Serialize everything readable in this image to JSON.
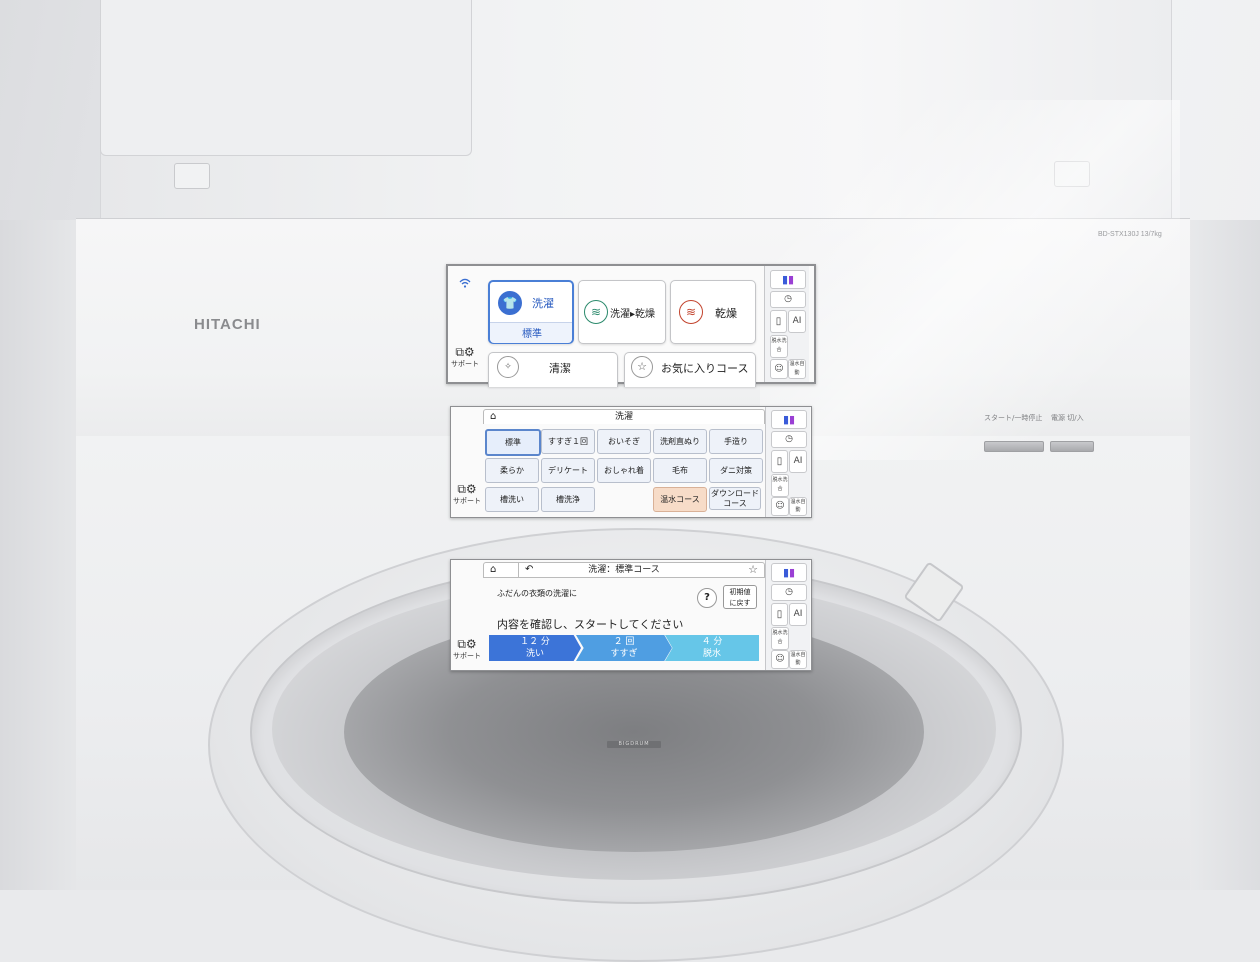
{
  "brand": "HITACHI",
  "model": "BD-STX130J 13/7kg",
  "hardware_buttons": {
    "start_label": "スタート/一時停止",
    "power_label": "電源 切/入"
  },
  "drum_label": "BIGDRUM",
  "common": {
    "support_label": "サポート",
    "right_panel": {
      "detergent": "洗剤",
      "timer": "タイマー",
      "ai": "AI",
      "dehydrate_mix": "脱水洗合",
      "auto_temp": "温水自動"
    }
  },
  "screen1": {
    "tiles": {
      "wash": "洗濯",
      "wash_sub": "標準",
      "wash_dry": "洗濯▸乾燥",
      "dry": "乾燥",
      "clean": "清潔",
      "favorite": "お気に入りコース"
    }
  },
  "screen2": {
    "title": "洗濯",
    "courses": [
      "標準",
      "すすぎ１回",
      "おいそぎ",
      "洗剤直ぬり",
      "手造り",
      "柔らか",
      "デリケート",
      "おしゃれ着",
      "毛布",
      "ダニ対策",
      "槽洗い",
      "槽洗浄",
      "",
      "温水コース",
      "ダウンロードコース"
    ],
    "download_line1": "ダウンロード",
    "download_line2": "コース"
  },
  "screen3": {
    "title": "洗濯：標準コース",
    "subtitle": "ふだんの衣類の洗濯に",
    "instruction": "内容を確認し、スタートしてください",
    "help_symbol": "?",
    "reset_line1": "初期値",
    "reset_line2": "に戻す",
    "steps": [
      {
        "time": "１２ 分",
        "name": "洗い"
      },
      {
        "time": "２ 回",
        "name": "すすぎ"
      },
      {
        "time": "４ 分",
        "name": "脱水"
      }
    ]
  },
  "colors": {
    "accent_blue": "#4a7fd6",
    "wash_icon": "#3b6fd1",
    "washdry_icon": "#2b8a6c",
    "dry_icon": "#c2432d",
    "warm_course": "#f7dcc8"
  }
}
